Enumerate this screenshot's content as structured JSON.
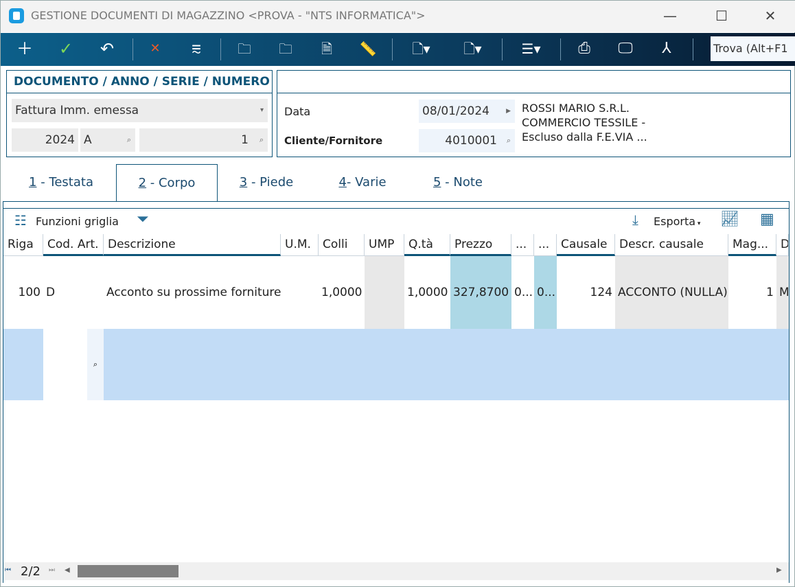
{
  "window": {
    "title": "GESTIONE DOCUMENTI DI MAGAZZINO <PROVA - \"NTS INFORMATICA\">",
    "minimize": "—",
    "maximize": "☐",
    "close": "✕"
  },
  "toolbar": {
    "items": [
      "new-icon",
      "confirm-icon",
      "undo-icon",
      "delete-icon",
      "restore-icon",
      "folder-red-icon",
      "folder-yellow-icon",
      "document-yellow-icon",
      "ruler-icon",
      "doc-minus-dropdown-icon",
      "doc-dropdown-icon",
      "menu-dropdown-icon",
      "print-icon",
      "monitor-icon",
      "pdf-icon",
      "search-icon"
    ],
    "search_placeholder": "Trova (Alt+F1"
  },
  "doc_panel": {
    "title": "DOCUMENTO / ANNO / SERIE / NUMERO",
    "tipo": "Fattura Imm. emessa",
    "anno": "2024",
    "serie": "A",
    "numero": "1"
  },
  "info_panel": {
    "data_label": "Data",
    "data_value": "08/01/2024",
    "cliente_label": "Cliente/Fornitore",
    "cliente_value": "4010001",
    "cliente_desc": [
      "ROSSI MARIO S.R.L.",
      "COMMERCIO TESSILE -",
      "Escluso dalla F.E.VIA ..."
    ]
  },
  "tabs": [
    {
      "key": "1",
      "label": " - Testata"
    },
    {
      "key": "2",
      "label": " - Corpo"
    },
    {
      "key": "3",
      "label": " - Piede"
    },
    {
      "key": "4",
      "label": "- Varie"
    },
    {
      "key": "5",
      "label": " - Note"
    }
  ],
  "active_tab": 1,
  "grid_toolbar": {
    "funzioni": "Funzioni griglia",
    "esporta": "Esporta"
  },
  "grid": {
    "columns": [
      "Riga",
      "Cod. Art.",
      "Descrizione",
      "U.M.",
      "Colli",
      "UMP",
      "Q.tà",
      "Prezzo",
      "...",
      "...",
      "Causale",
      "Descr. causale",
      "Mag...",
      "D"
    ],
    "rows": [
      [
        "100",
        "D",
        "Acconto su prossime forniture",
        "",
        "1,0000",
        "",
        "1,0000",
        "327,8700",
        "0...",
        "0...",
        "124",
        "ACCONTO (NULLA)",
        "1",
        "M"
      ]
    ]
  },
  "pager": {
    "text": "2/2"
  },
  "colors": {
    "accent": "#0d5478",
    "highlight": "#add8e6",
    "new_row": "#c2dcf6"
  }
}
